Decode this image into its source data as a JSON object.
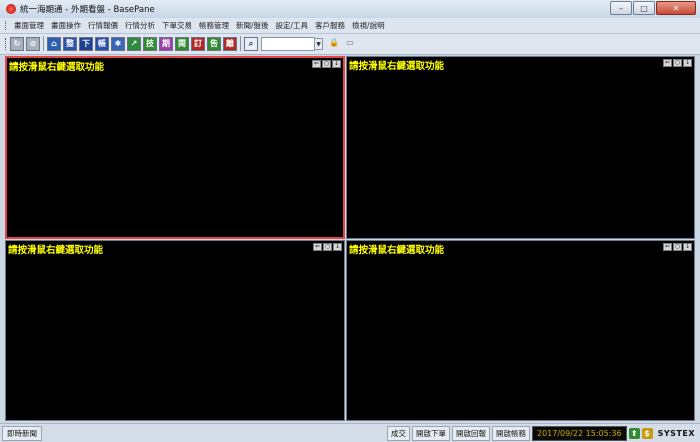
{
  "window": {
    "title": "統一海期通 - 外期看盤 - BasePane",
    "controls": {
      "minimize": "–",
      "maximize": "□",
      "close": "✕"
    }
  },
  "menu": [
    "畫面管理",
    "畫面操作",
    "行情報價",
    "行情分析",
    "下單交易",
    "帳務管理",
    "新聞/盤後",
    "設定/工具",
    "客戶服務",
    "檢視/說明"
  ],
  "toolbar": {
    "buttons": [
      {
        "icon": "swirl-icon",
        "glyph": "↻",
        "color": "#a8b0bc"
      },
      {
        "icon": "lock-icon",
        "glyph": "⊘",
        "color": "#a8b0bc"
      },
      {
        "icon": "home-icon",
        "glyph": "⌂",
        "color": "#2d5fb0"
      },
      {
        "icon": "整",
        "glyph": "整",
        "color": "#2a54a8"
      },
      {
        "icon": "下",
        "glyph": "下",
        "color": "#1f3f90"
      },
      {
        "icon": "帳",
        "glyph": "帳",
        "color": "#2750a6"
      },
      {
        "icon": "gear-icon",
        "glyph": "✱",
        "color": "#3a64b4"
      },
      {
        "icon": "chart-icon",
        "glyph": "↗",
        "color": "#2d8a3a"
      },
      {
        "icon": "技",
        "glyph": "技",
        "color": "#2f8a30"
      },
      {
        "icon": "期",
        "glyph": "期",
        "color": "#9a3fa8"
      },
      {
        "icon": "閱",
        "glyph": "閱",
        "color": "#2f8a30"
      },
      {
        "icon": "訂",
        "glyph": "訂",
        "color": "#b02a2a"
      },
      {
        "icon": "告",
        "glyph": "告",
        "color": "#2f8a30"
      },
      {
        "icon": "離",
        "glyph": "離",
        "color": "#b02a2a"
      }
    ],
    "search": {
      "icon": "magnifier-icon",
      "glyph": "⌕",
      "value": ""
    },
    "extra": [
      {
        "icon": "lock-icon",
        "glyph": "🔒",
        "color": "#d5a31a"
      },
      {
        "icon": "window-icon",
        "glyph": "▭",
        "color": "#5a6a84"
      }
    ]
  },
  "panes": {
    "hint": "請按滑鼠右鍵選取功能",
    "controls": [
      "⇐",
      "○",
      "↓"
    ]
  },
  "status": {
    "news": "即時新聞",
    "buttons": [
      "成交",
      "開啟下單",
      "開啟回報",
      "開啟帳務"
    ],
    "datetime": "2017/09/22 15:05:36",
    "brand": "SYSTEX",
    "icons": [
      {
        "name": "up-arrow-icon",
        "glyph": "⬆",
        "color": "#2f8a30"
      },
      {
        "name": "dollar-icon",
        "glyph": "$",
        "color": "#c89a10"
      }
    ]
  }
}
